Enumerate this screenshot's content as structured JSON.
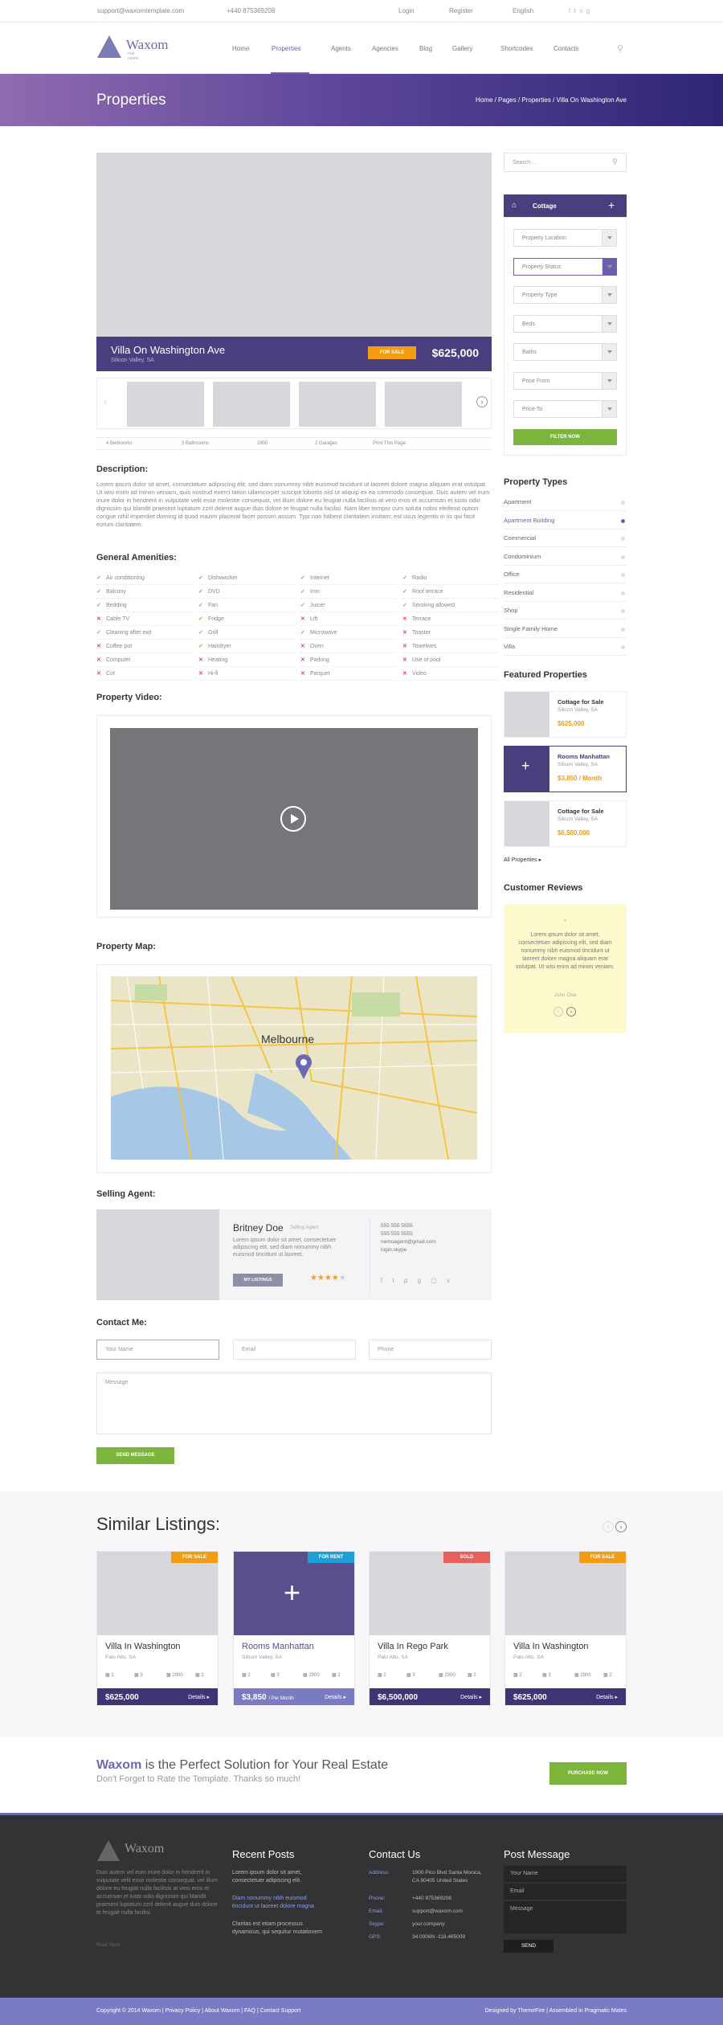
{
  "topbar": {
    "email": "support@waxomtemplate.com",
    "phone": "+440 875369208",
    "login": "Login",
    "register": "Register",
    "language": "English"
  },
  "logo": {
    "name": "Waxom",
    "tag": "real estate"
  },
  "nav": {
    "items": [
      "Home",
      "Properties",
      "Agents",
      "Agencies",
      "Blog",
      "Gallery",
      "Shortcodes",
      "Contacts"
    ]
  },
  "banner": {
    "title": "Properties",
    "crumbs": "Home  /  Pages  /  Properties  /  Villa On Washington Ave"
  },
  "listing": {
    "title": "Villa On Washington Ave",
    "location": "Silicon Valley, SA",
    "badge": "FOR SALE",
    "price": "$625,000"
  },
  "features": [
    "4 Bedrooms",
    "3 Bathrooms",
    "2900",
    "2 Garages",
    "Print This Page"
  ],
  "description": {
    "heading": "Description:",
    "text": "Lorem ipsum dolor sit amet, consectetuer adipiscing elit, sed diam nonummy nibh euismod tincidunt ut laoreet dolore magna aliquam erat volutpat. Ut wisi enim ad minim veniam, quis nostrud exerci tation ullamcorper suscipit lobortis nisl ut aliquip ex ea commodo consequat. Duis autem vel eum iriure dolor in hendrerit in vulputate velit esse molestie consequat, vel illum dolore eu feugiat nulla facilisis at vero eros et accumsan et iusto odio dignissim qui blandit praesent luptatum zzril delenit augue duis dolore te feugait nulla facilisi. Nam liber tempor cum soluta nobis eleifend option congue nihil imperdiet doming id quod mazim placerat facer possim assum. Typi non habent claritatem insitam; est usus legentis in iis qui facit eorum claritatem."
  },
  "amenities": {
    "heading": "General Amenities:",
    "columns": [
      [
        [
          "Air conditioning",
          1
        ],
        [
          "Balcony",
          1
        ],
        [
          "Bedding",
          1
        ],
        [
          "Cable TV",
          0
        ],
        [
          "Cleaning after exit",
          1
        ],
        [
          "Coffee pot",
          0
        ],
        [
          "Computer",
          0
        ],
        [
          "Cot",
          0
        ]
      ],
      [
        [
          "Dishwasher",
          1
        ],
        [
          "DVD",
          1
        ],
        [
          "Fan",
          1
        ],
        [
          "Fridge",
          1
        ],
        [
          "Grill",
          1
        ],
        [
          "Hairdryer",
          1
        ],
        [
          "Heating",
          0
        ],
        [
          "Hi-fi",
          0
        ]
      ],
      [
        [
          "Internet",
          1
        ],
        [
          "Iron",
          1
        ],
        [
          "Juicer",
          1
        ],
        [
          "Lift",
          0
        ],
        [
          "Microwave",
          1
        ],
        [
          "Oven",
          0
        ],
        [
          "Parking",
          0
        ],
        [
          "Parquet",
          0
        ]
      ],
      [
        [
          "Radio",
          1
        ],
        [
          "Roof terrace",
          1
        ],
        [
          "Smoking allowed",
          1
        ],
        [
          "Terrace",
          0
        ],
        [
          "Toaster",
          0
        ],
        [
          "Towelwes",
          0
        ],
        [
          "Use of pool",
          0
        ],
        [
          "Video",
          0
        ]
      ]
    ]
  },
  "video": {
    "heading": "Property Video:"
  },
  "map": {
    "heading": "Property Map:",
    "city": "Melbourne"
  },
  "agent": {
    "heading": "Selling Agent:",
    "name": "Britney Doe",
    "role": "Selling Agent",
    "bio": "Lorem ipsum dolor sit amet, consectetuer adipiscing elit, sed diam nonummy nibh euismod tincidunt ut laoreet.",
    "button": "MY LISTINGS",
    "phone1": "555 555 5555",
    "phone2": "555 555 5555",
    "email": "nemoagent@gmail.com",
    "skype": "login.skype"
  },
  "contact": {
    "heading": "Contact Me:",
    "name_ph": "Your Name",
    "email_ph": "Email",
    "phone_ph": "Phone",
    "message_ph": "Message",
    "send": "SEND MESSAGE"
  },
  "sidebar": {
    "search_ph": "Search...",
    "search_tab": "Cottage",
    "selects": [
      "Property Location",
      "Property Status",
      "Property Type",
      "Beds",
      "Baths",
      "Price From",
      "Price To"
    ],
    "filter": "FILTER NOW",
    "types_heading": "Property Types",
    "types": [
      "Apartment",
      "Apartment Building",
      "Commercial",
      "Condominium",
      "Office",
      "Residential",
      "Shop",
      "Single Family Home",
      "Villa"
    ],
    "featured_heading": "Featured Properties",
    "featured": [
      {
        "title": "Cottage for Sale",
        "loc": "Silicon Valley, SA",
        "price": "$625,000"
      },
      {
        "title": "Rooms Manhattan",
        "loc": "Silicon Valley, SA",
        "price": "$3,850 / Month"
      },
      {
        "title": "Cottage for Sale",
        "loc": "Silicon Valley, SA",
        "price": "$6,500,000"
      }
    ],
    "all_props": "All Properties",
    "reviews_heading": "Customer Reviews",
    "review": "Lorem ipsum dolor sit amet, consectetuer adipiscing elit, sed diam nonummy nibh euismod tincidunt ut laoreet dolore magna aliquam erat volutpat. Ut wisi enim ad minim veniam.",
    "reviewer": "John Doe"
  },
  "similar": {
    "heading": "Similar Listings:",
    "cards": [
      {
        "badge": "FOR SALE",
        "badge_color": "#f39c12",
        "title": "Villa In Washington",
        "loc": "Palo Alto, SA",
        "price": "$625,000",
        "details": "Details"
      },
      {
        "badge": "FOR RENT",
        "badge_color": "#1e9fd8",
        "title": "Rooms Manhattan",
        "loc": "Silicon Valley, SA",
        "price": "$3,850",
        "per": "/ Per Month",
        "details": "Details"
      },
      {
        "badge": "SOLD",
        "badge_color": "#e8605a",
        "title": "Villa In Rego Park",
        "loc": "Palo Alto, SA",
        "price": "$6,500,000",
        "details": "Details"
      },
      {
        "badge": "FOR SALE",
        "badge_color": "#f39c12",
        "title": "Villa In Washington",
        "loc": "Palo Alto, SA",
        "price": "$625,000",
        "details": "Details"
      }
    ],
    "features": [
      "2",
      "3",
      "2900",
      "2"
    ]
  },
  "promo": {
    "brand": "Waxom",
    "headline": " is the Perfect Solution for Your Real Estate",
    "sub": "Don't Forget to Rate the Template. Thanks so much!",
    "button": "PURCHASE NOW"
  },
  "footer": {
    "about": "Duis autem vel eum iriure dolor in hendrerit in vulputate velit esse molestie consequat, vel illum dolore eu feugiat nulla facilisis at vero eros et accumsan et iusto odio dignissim qui blandit praesent luptatum zzril delenit augue duis dolore te feugait nulla facilisi.",
    "read_more": "Read More",
    "posts_heading": "Recent Posts",
    "posts": [
      "Lorem ipsum dolor sit amet, consectetuer adipiscing elit.",
      "Diam nonummy nibh euismod tincidunt ut laoreet dolore magna",
      "Claritas est etiam processus dynamicus, qui sequitur mutationem"
    ],
    "contact_heading": "Contact Us",
    "address_label": "Address:",
    "address": "1900 Pico Blvd Santa Monica, CA 90405 United States",
    "phone_label": "Phone:",
    "phone": "+440 875369208",
    "email_label": "Email:",
    "email": "support@waxom.com",
    "skype_label": "Skype:",
    "skype": "your.company",
    "gps_label": "GPS:",
    "gps": "34.0006N -118.465009",
    "post_heading": "Post Message",
    "name_ph": "Your Name",
    "email_ph": "Email",
    "msg_ph": "Message",
    "send": "SEND"
  },
  "copyright": {
    "left": "Copyright © 2014 Waxom  |  Privacy Policy  |  About Waxom  |  FAQ  |  Contact Support",
    "right": "Designed by ThemeFire  |  Assembled in Pragmatic Mates"
  },
  "colors": {
    "accent": "#4b3e7e",
    "green": "#7cb53c",
    "orange": "#f39c12"
  }
}
